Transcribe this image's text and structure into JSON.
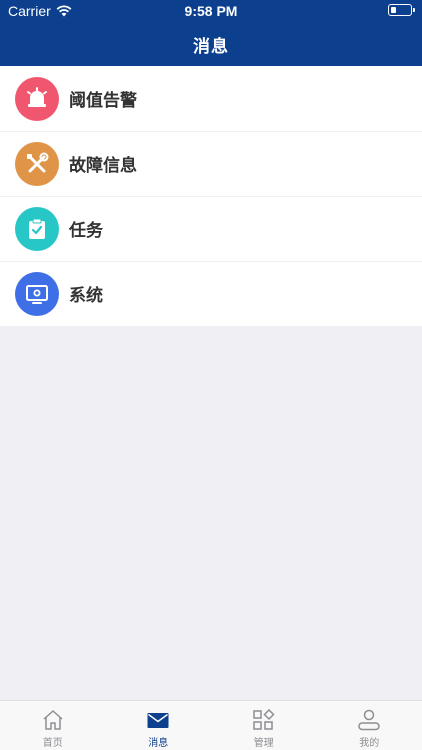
{
  "status_bar": {
    "carrier": "Carrier",
    "time": "9:58 PM"
  },
  "nav": {
    "title": "消息"
  },
  "list": {
    "items": [
      {
        "label": "阈值告警",
        "icon": "alarm-bell-icon",
        "color": "#f0576f"
      },
      {
        "label": "故障信息",
        "icon": "tools-icon",
        "color": "#e09447"
      },
      {
        "label": "任务",
        "icon": "clipboard-check-icon",
        "color": "#28c7c7"
      },
      {
        "label": "系统",
        "icon": "monitor-settings-icon",
        "color": "#3f6fe6"
      }
    ]
  },
  "tabbar": {
    "tabs": [
      {
        "label": "首页",
        "icon": "home-icon"
      },
      {
        "label": "消息",
        "icon": "mail-icon",
        "active": true
      },
      {
        "label": "管理",
        "icon": "grid-icon"
      },
      {
        "label": "我的",
        "icon": "user-icon"
      }
    ],
    "active_color": "#0c3f8d",
    "inactive_color": "#8e8e93"
  },
  "theme": {
    "primary": "#0c3f8d",
    "background": "#efeff4"
  }
}
